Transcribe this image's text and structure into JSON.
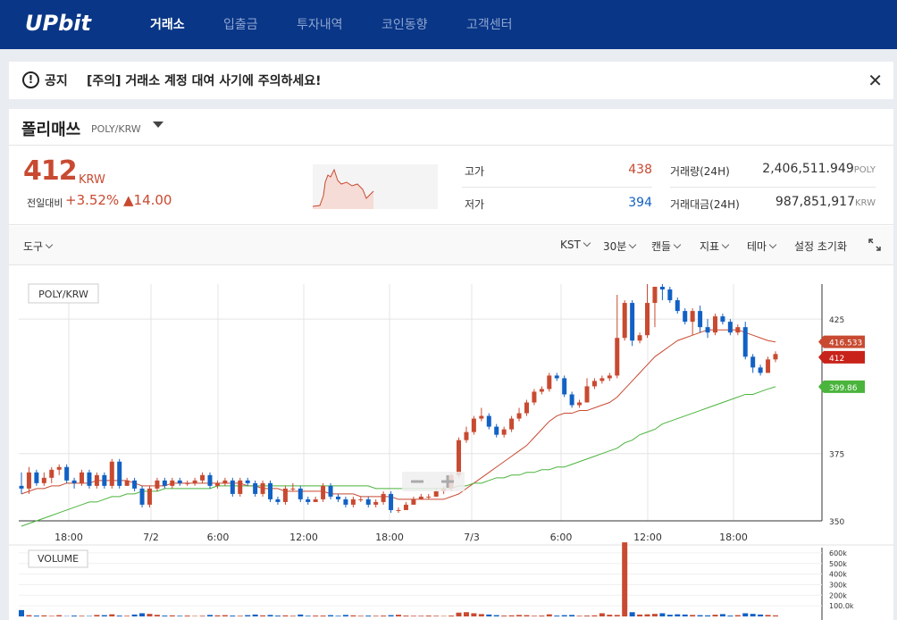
{
  "nav": {
    "logo": "UPbit",
    "items": [
      {
        "label": "거래소",
        "active": true
      },
      {
        "label": "입출금",
        "active": false
      },
      {
        "label": "투자내역",
        "active": false
      },
      {
        "label": "코인동향",
        "active": false
      },
      {
        "label": "고객센터",
        "active": false
      }
    ]
  },
  "notice": {
    "icon": "!",
    "label": "공지",
    "text": "[주의] 거래소 계정 대여 사기에 주의하세요!",
    "close": "✕"
  },
  "coin": {
    "name": "폴리매쓰",
    "pair": "POLY/KRW",
    "price": "412",
    "unit": "KRW",
    "change_label": "전일대비",
    "change_pct": "+3.52%",
    "change_amt": "▲14.00"
  },
  "stats": {
    "high_label": "고가",
    "high": "438",
    "low_label": "저가",
    "low": "394",
    "vol_label": "거래량(24H)",
    "vol": "2,406,511.949",
    "vol_unit": "POLY",
    "amt_label": "거래대금(24H)",
    "amt": "987,851,917",
    "amt_unit": "KRW"
  },
  "toolbar": {
    "tools": "도구",
    "timezone": "KST",
    "interval": "30분",
    "style": "캔들",
    "indicator": "지표",
    "theme": "테마",
    "reset": "설정 초기화",
    "expand_icon": "expand-icon"
  },
  "colors": {
    "up": "#c84a31",
    "down": "#1261c4",
    "ma_short": "#c84a31",
    "ma_long": "#4ab43c",
    "nav": "#093687"
  },
  "chart_data": {
    "type": "candlestick",
    "title": "POLY/KRW",
    "x_ticks": [
      "18:00",
      "7/2",
      "6:00",
      "12:00",
      "18:00",
      "7/3",
      "6:00",
      "12:00",
      "18:00"
    ],
    "y_ticks": [
      350,
      375,
      425
    ],
    "ylim": [
      350,
      438
    ],
    "price_labels": {
      "ma_short": "416.533",
      "last": "412",
      "ma_long": "399.86"
    },
    "candles": [
      [
        363,
        362,
        368,
        360
      ],
      [
        362,
        368,
        370,
        360
      ],
      [
        368,
        364,
        369,
        363
      ],
      [
        364,
        366,
        368,
        363
      ],
      [
        366,
        369,
        370,
        364
      ],
      [
        369,
        370,
        371,
        367
      ],
      [
        370,
        365,
        371,
        364
      ],
      [
        365,
        364,
        366,
        362
      ],
      [
        364,
        368,
        369,
        363
      ],
      [
        368,
        363,
        369,
        362
      ],
      [
        363,
        367,
        368,
        362
      ],
      [
        367,
        363,
        368,
        362
      ],
      [
        363,
        372,
        373,
        362
      ],
      [
        372,
        363,
        373,
        362
      ],
      [
        363,
        365,
        366,
        363
      ],
      [
        365,
        362,
        366,
        361
      ],
      [
        362,
        356,
        363,
        355
      ],
      [
        356,
        362,
        363,
        355
      ],
      [
        362,
        365,
        366,
        361
      ],
      [
        365,
        363,
        366,
        362
      ],
      [
        363,
        365,
        366,
        362
      ],
      [
        365,
        364,
        366,
        363
      ],
      [
        364,
        364,
        365,
        363
      ],
      [
        364,
        365,
        366,
        363
      ],
      [
        365,
        367,
        368,
        364
      ],
      [
        367,
        363,
        368,
        362
      ],
      [
        363,
        364,
        365,
        362
      ],
      [
        364,
        365,
        366,
        363
      ],
      [
        365,
        360,
        366,
        359
      ],
      [
        360,
        365,
        366,
        359
      ],
      [
        365,
        364,
        366,
        363
      ],
      [
        364,
        360,
        365,
        359
      ],
      [
        360,
        364,
        365,
        359
      ],
      [
        364,
        358,
        365,
        357
      ],
      [
        358,
        357,
        359,
        356
      ],
      [
        357,
        362,
        363,
        356
      ],
      [
        362,
        362,
        364,
        361
      ],
      [
        362,
        358,
        363,
        357
      ],
      [
        358,
        357,
        359,
        356
      ],
      [
        357,
        358,
        359,
        357
      ],
      [
        358,
        363,
        364,
        357
      ],
      [
        363,
        359,
        364,
        358
      ],
      [
        359,
        358,
        360,
        357
      ],
      [
        358,
        356,
        359,
        355
      ],
      [
        356,
        358,
        359,
        355
      ],
      [
        358,
        358,
        359,
        357
      ],
      [
        358,
        356,
        359,
        355
      ],
      [
        356,
        357,
        358,
        355
      ],
      [
        357,
        360,
        361,
        356
      ],
      [
        360,
        354,
        361,
        353
      ],
      [
        354,
        354,
        355,
        353
      ],
      [
        354,
        356,
        357,
        354
      ],
      [
        356,
        358,
        359,
        356
      ],
      [
        358,
        359,
        360,
        358
      ],
      [
        359,
        359,
        360,
        358
      ],
      [
        359,
        361,
        362,
        359
      ],
      [
        361,
        362,
        363,
        360
      ],
      [
        362,
        367,
        368,
        361
      ],
      [
        367,
        380,
        381,
        366
      ],
      [
        380,
        383,
        385,
        379
      ],
      [
        383,
        388,
        389,
        382
      ],
      [
        388,
        389,
        392,
        387
      ],
      [
        389,
        385,
        390,
        384
      ],
      [
        385,
        382,
        386,
        381
      ],
      [
        382,
        384,
        385,
        381
      ],
      [
        384,
        388,
        389,
        383
      ],
      [
        388,
        390,
        392,
        387
      ],
      [
        390,
        394,
        395,
        389
      ],
      [
        394,
        398,
        399,
        393
      ],
      [
        398,
        399,
        400,
        397
      ],
      [
        399,
        404,
        405,
        398
      ],
      [
        404,
        403,
        405,
        402
      ],
      [
        403,
        397,
        404,
        396
      ],
      [
        397,
        393,
        398,
        392
      ],
      [
        393,
        394,
        395,
        392
      ],
      [
        394,
        400,
        403,
        394
      ],
      [
        400,
        402,
        403,
        399
      ],
      [
        402,
        403,
        404,
        401
      ],
      [
        403,
        404,
        405,
        402
      ],
      [
        404,
        418,
        434,
        403
      ],
      [
        418,
        431,
        432,
        417
      ],
      [
        431,
        417,
        432,
        415
      ],
      [
        417,
        419,
        420,
        416
      ],
      [
        419,
        431,
        438,
        418
      ],
      [
        431,
        437,
        437,
        422
      ],
      [
        437,
        436,
        438,
        432
      ],
      [
        436,
        432,
        437,
        431
      ],
      [
        432,
        428,
        433,
        427
      ],
      [
        428,
        424,
        429,
        423
      ],
      [
        424,
        428,
        429,
        419
      ],
      [
        428,
        422,
        430,
        420
      ],
      [
        422,
        420,
        425,
        418
      ],
      [
        420,
        426,
        427,
        419
      ],
      [
        426,
        424,
        427,
        423
      ],
      [
        424,
        420,
        425,
        419
      ],
      [
        420,
        422,
        423,
        419
      ],
      [
        422,
        411,
        424,
        410
      ],
      [
        411,
        407,
        412,
        405
      ],
      [
        407,
        405,
        408,
        404
      ],
      [
        405,
        410,
        411,
        405
      ],
      [
        410,
        412,
        413,
        409
      ]
    ],
    "ma_short": [
      360,
      361,
      362,
      362,
      363,
      363,
      364,
      364,
      364,
      364,
      365,
      365,
      365,
      365,
      365,
      364,
      363,
      363,
      363,
      363,
      364,
      364,
      364,
      364,
      364,
      364,
      364,
      364,
      364,
      364,
      363,
      363,
      362,
      362,
      362,
      361,
      361,
      361,
      361,
      361,
      361,
      360,
      360,
      360,
      360,
      359,
      359,
      359,
      359,
      359,
      358,
      358,
      358,
      358,
      358,
      358,
      358,
      359,
      360,
      362,
      364,
      366,
      368,
      370,
      372,
      374,
      376,
      378,
      381,
      384,
      387,
      389,
      390,
      390,
      391,
      391,
      392,
      393,
      394,
      396,
      399,
      402,
      405,
      408,
      411,
      413,
      415,
      417,
      418,
      419,
      420,
      421,
      421,
      421,
      421,
      421,
      420,
      419,
      418,
      417,
      416.5
    ],
    "ma_long": [
      348,
      349,
      350,
      351,
      352,
      353,
      354,
      355,
      356,
      357,
      357,
      358,
      359,
      359,
      360,
      360,
      361,
      361,
      361,
      362,
      362,
      362,
      362,
      362,
      362,
      362,
      363,
      363,
      363,
      363,
      363,
      363,
      363,
      363,
      363,
      363,
      363,
      363,
      363,
      363,
      363,
      363,
      363,
      363,
      363,
      363,
      363,
      362,
      362,
      362,
      362,
      362,
      362,
      362,
      362,
      362,
      362,
      362,
      363,
      363,
      364,
      364,
      365,
      366,
      366,
      367,
      367,
      368,
      368,
      369,
      369,
      370,
      370,
      371,
      372,
      373,
      374,
      375,
      376,
      377,
      379,
      380,
      382,
      383,
      384,
      386,
      387,
      388,
      389,
      390,
      391,
      392,
      393,
      394,
      395,
      396,
      397,
      397,
      398,
      399,
      399.86
    ],
    "volume_ticks": [
      "600k",
      "500k",
      "400k",
      "300k",
      "200k",
      "100.0k"
    ],
    "volume_label": "VOLUME",
    "volumes": [
      60,
      12,
      8,
      10,
      5,
      12,
      3,
      8,
      6,
      4,
      14,
      12,
      20,
      8,
      6,
      18,
      30,
      24,
      15,
      8,
      10,
      6,
      8,
      4,
      6,
      14,
      10,
      12,
      8,
      6,
      12,
      18,
      10,
      14,
      8,
      10,
      6,
      18,
      6,
      8,
      8,
      12,
      6,
      14,
      10,
      6,
      8,
      6,
      8,
      12,
      16,
      8,
      6,
      6,
      8,
      6,
      4,
      8,
      36,
      40,
      30,
      22,
      18,
      12,
      8,
      10,
      14,
      12,
      6,
      8,
      20,
      8,
      12,
      14,
      6,
      8,
      10,
      30,
      16,
      14,
      700,
      40,
      18,
      20,
      24,
      30,
      16,
      20,
      18,
      14,
      12,
      10,
      16,
      22,
      8,
      12,
      30,
      24,
      18,
      14,
      10
    ]
  }
}
